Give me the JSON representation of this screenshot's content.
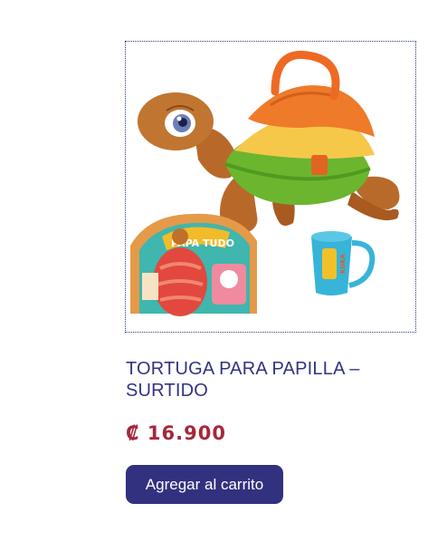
{
  "product": {
    "image_alt": "TORTUGA PARA PAPILLA – SURTIDO",
    "title": "TORTUGA PARA PAPILLA – SURTIDO",
    "price": "₡ 16.900",
    "add_to_cart_label": "Agregar al carrito",
    "box_label": "PAPA TUDO",
    "mug_label": "KUKA"
  },
  "colors": {
    "title": "#323380",
    "price": "#a5283a",
    "button_bg": "#32317f",
    "frame_border": "#2b3a8c"
  }
}
